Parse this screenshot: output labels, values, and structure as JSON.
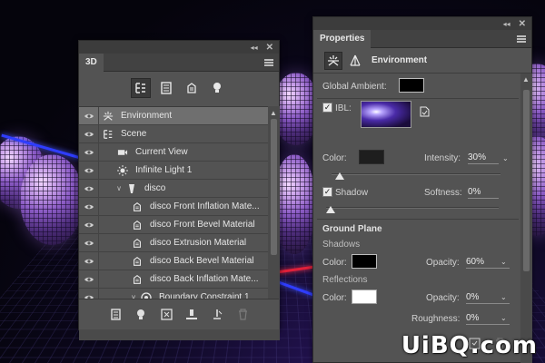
{
  "panel3d": {
    "tab": "3D",
    "rows": [
      {
        "label": "Environment",
        "selected": true,
        "icon": "environment-icon"
      },
      {
        "label": "Scene",
        "icon": "scene-icon"
      },
      {
        "label": "Current View",
        "icon": "camera-icon"
      },
      {
        "label": "Infinite Light 1",
        "icon": "light-icon"
      },
      {
        "label": "disco",
        "icon": "mesh-icon",
        "expanded": true
      },
      {
        "label": "disco Front Inflation Mate...",
        "icon": "material-icon"
      },
      {
        "label": "disco Front Bevel Material",
        "icon": "material-icon"
      },
      {
        "label": "disco Extrusion Material",
        "icon": "material-icon"
      },
      {
        "label": "disco Back Bevel Material",
        "icon": "material-icon"
      },
      {
        "label": "disco Back Inflation Mate...",
        "icon": "material-icon"
      },
      {
        "label": "Boundary Constraint 1",
        "icon": "constraint-icon",
        "expanded": true
      }
    ],
    "filter_icons": [
      "whole-scene-icon",
      "meshes-icon",
      "materials-icon",
      "lights-icon"
    ],
    "bottom_icons": [
      "render-settings-icon",
      "add-light-icon",
      "new-object-icon",
      "drop-to-ground-icon",
      "constraint-icon",
      "delete-icon"
    ]
  },
  "properties": {
    "tab": "Properties",
    "title": "Environment",
    "global_ambient_label": "Global Ambient:",
    "ibl_label": "IBL:",
    "color_label": "Color:",
    "intensity_label": "Intensity:",
    "intensity_value": "30%",
    "shadow_label": "Shadow",
    "softness_label": "Softness:",
    "softness_value": "0%",
    "ground_plane_heading": "Ground Plane",
    "shadows_heading": "Shadows",
    "shadows_color_label": "Color:",
    "shadows_opacity_label": "Opacity:",
    "shadows_opacity_value": "60%",
    "reflections_heading": "Reflections",
    "reflections_color_label": "Color:",
    "reflections_opacity_label": "Opacity:",
    "reflections_opacity_value": "0%",
    "roughness_label": "Roughness:",
    "roughness_value": "0%",
    "ibl_checked": true,
    "shadow_checked": true,
    "intensity_slider_level": 0.05,
    "softness_slider_level": 0.0
  },
  "watermark": "UiBQ.com",
  "colors": {
    "panel": "#535353",
    "laser_blue": "#2f3dff",
    "laser_red": "#e0203a"
  }
}
